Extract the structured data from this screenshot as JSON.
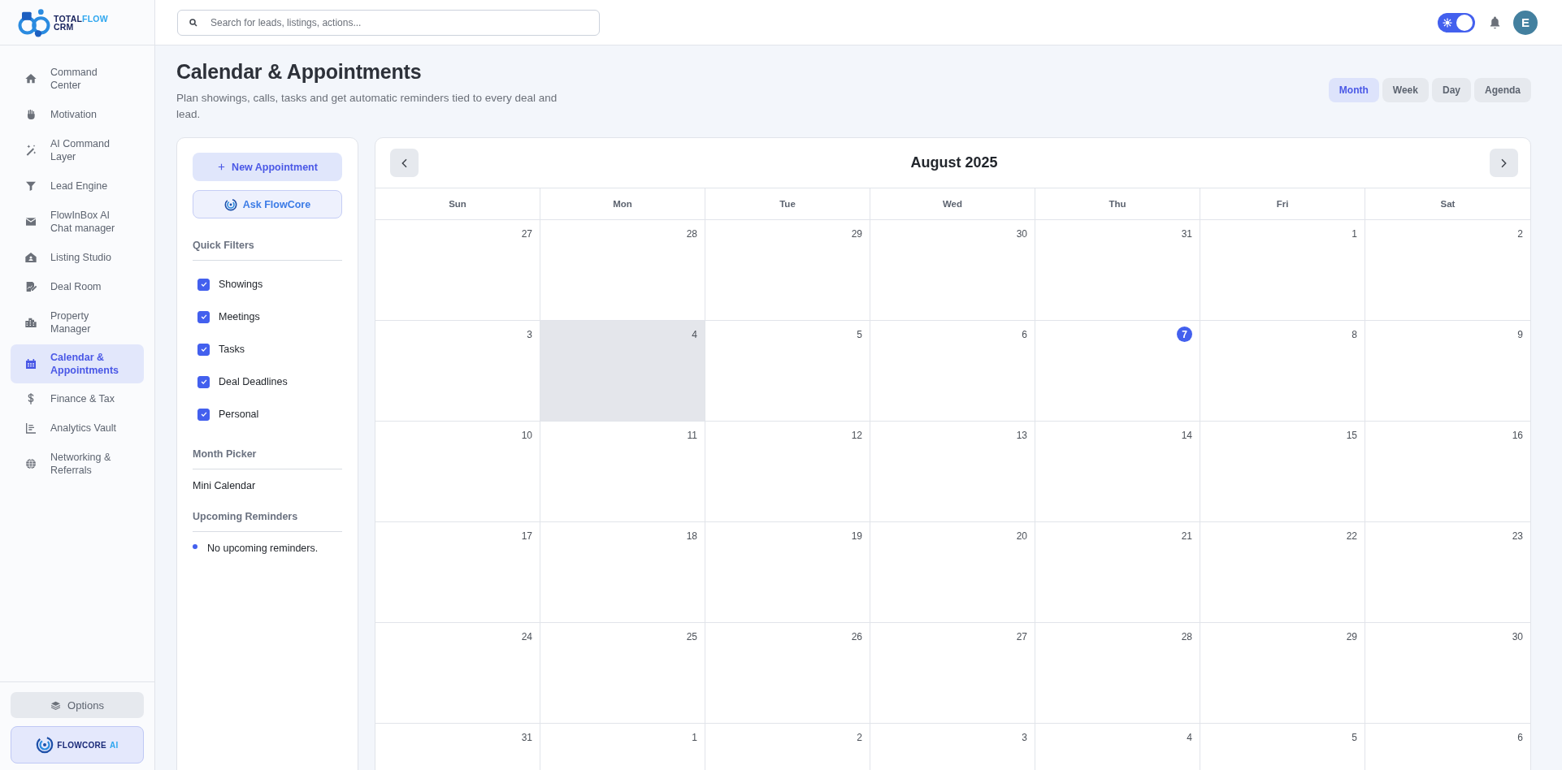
{
  "sidebar": {
    "logo": {
      "word_1": "TOTAL",
      "word_2": "FLOW",
      "word_3": "CRM"
    },
    "items": [
      {
        "label": "Command Center",
        "selected": false
      },
      {
        "label": "Motivation",
        "selected": false
      },
      {
        "label": "AI Command Layer",
        "selected": false
      },
      {
        "label": "Lead Engine",
        "selected": false
      },
      {
        "label": "FlowInBox AI Chat manager",
        "selected": false
      },
      {
        "label": "Listing Studio",
        "selected": false
      },
      {
        "label": "Deal Room",
        "selected": false
      },
      {
        "label": "Property Manager",
        "selected": false
      },
      {
        "label": "Calendar & Appointments",
        "selected": true
      },
      {
        "label": "Finance & Tax",
        "selected": false
      },
      {
        "label": "Analytics Vault",
        "selected": false
      },
      {
        "label": "Networking & Referrals",
        "selected": false
      }
    ],
    "options_button": "Options",
    "brand_button": {
      "word_1": "FLOWCORE",
      "word_2": "AI"
    }
  },
  "header": {
    "search": {
      "placeholder": "Search for leads, listings, actions..."
    },
    "theme_toggle": {
      "on": true
    },
    "avatar": "E"
  },
  "page": {
    "title": "Calendar & Appointments",
    "subtitle": "Plan showings, calls, tasks and get automatic reminders tied to every deal and lead.",
    "views": [
      {
        "label": "Month",
        "selected": true
      },
      {
        "label": "Week",
        "selected": false
      },
      {
        "label": "Day",
        "selected": false
      },
      {
        "label": "Agenda",
        "selected": false
      }
    ]
  },
  "filter_panel": {
    "new_button": "New Appointment",
    "ask_button": "Ask FlowCore",
    "quick_filters": {
      "heading": "Quick Filters",
      "items": [
        {
          "label": "Showings",
          "checked": true
        },
        {
          "label": "Meetings",
          "checked": true
        },
        {
          "label": "Tasks",
          "checked": true
        },
        {
          "label": "Deal Deadlines",
          "checked": true
        },
        {
          "label": "Personal",
          "checked": true
        }
      ]
    },
    "month_picker": {
      "heading": "Month Picker",
      "text": "Mini Calendar"
    },
    "reminders": {
      "heading": "Upcoming Reminders",
      "items": [
        "No upcoming reminders."
      ]
    }
  },
  "calendar": {
    "title": "August 2025",
    "weekdays": [
      "Sun",
      "Mon",
      "Tue",
      "Wed",
      "Thu",
      "Fri",
      "Sat"
    ],
    "weeks": [
      [
        {
          "day": "27",
          "today": false,
          "selected": false
        },
        {
          "day": "28",
          "today": false,
          "selected": false
        },
        {
          "day": "29",
          "today": false,
          "selected": false
        },
        {
          "day": "30",
          "today": false,
          "selected": false
        },
        {
          "day": "31",
          "today": false,
          "selected": false
        },
        {
          "day": "1",
          "today": false,
          "selected": false
        },
        {
          "day": "2",
          "today": false,
          "selected": false
        }
      ],
      [
        {
          "day": "3",
          "today": false,
          "selected": false
        },
        {
          "day": "4",
          "today": false,
          "selected": true
        },
        {
          "day": "5",
          "today": false,
          "selected": false
        },
        {
          "day": "6",
          "today": false,
          "selected": false
        },
        {
          "day": "7",
          "today": true,
          "selected": false
        },
        {
          "day": "8",
          "today": false,
          "selected": false
        },
        {
          "day": "9",
          "today": false,
          "selected": false
        }
      ],
      [
        {
          "day": "10",
          "today": false,
          "selected": false
        },
        {
          "day": "11",
          "today": false,
          "selected": false
        },
        {
          "day": "12",
          "today": false,
          "selected": false
        },
        {
          "day": "13",
          "today": false,
          "selected": false
        },
        {
          "day": "14",
          "today": false,
          "selected": false
        },
        {
          "day": "15",
          "today": false,
          "selected": false
        },
        {
          "day": "16",
          "today": false,
          "selected": false
        }
      ],
      [
        {
          "day": "17",
          "today": false,
          "selected": false
        },
        {
          "day": "18",
          "today": false,
          "selected": false
        },
        {
          "day": "19",
          "today": false,
          "selected": false
        },
        {
          "day": "20",
          "today": false,
          "selected": false
        },
        {
          "day": "21",
          "today": false,
          "selected": false
        },
        {
          "day": "22",
          "today": false,
          "selected": false
        },
        {
          "day": "23",
          "today": false,
          "selected": false
        }
      ],
      [
        {
          "day": "24",
          "today": false,
          "selected": false
        },
        {
          "day": "25",
          "today": false,
          "selected": false
        },
        {
          "day": "26",
          "today": false,
          "selected": false
        },
        {
          "day": "27",
          "today": false,
          "selected": false
        },
        {
          "day": "28",
          "today": false,
          "selected": false
        },
        {
          "day": "29",
          "today": false,
          "selected": false
        },
        {
          "day": "30",
          "today": false,
          "selected": false
        }
      ],
      [
        {
          "day": "31",
          "today": false,
          "selected": false
        },
        {
          "day": "1",
          "today": false,
          "selected": false
        },
        {
          "day": "2",
          "today": false,
          "selected": false
        },
        {
          "day": "3",
          "today": false,
          "selected": false
        },
        {
          "day": "4",
          "today": false,
          "selected": false
        },
        {
          "day": "5",
          "today": false,
          "selected": false
        },
        {
          "day": "6",
          "today": false,
          "selected": false
        }
      ]
    ]
  }
}
